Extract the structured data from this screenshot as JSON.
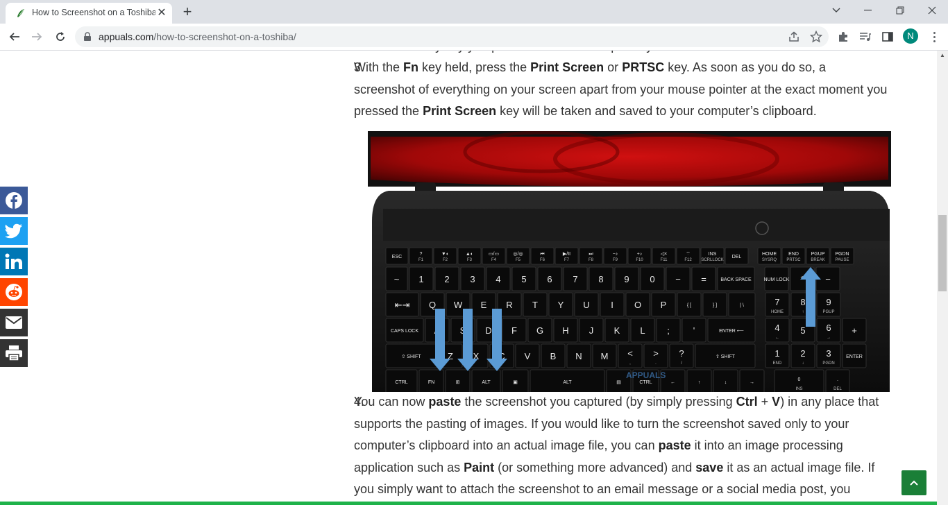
{
  "browser": {
    "tab_title": "How to Screenshot on a Toshiba",
    "url_domain": "appuals.com",
    "url_path": "/how-to-screenshot-on-a-toshiba/",
    "profile_initial": "N",
    "profile_color": "#00897b"
  },
  "article": {
    "prev_tail": "functions of any key you press instead of their primary ones.",
    "step3": {
      "num": "3.",
      "t1": "With the ",
      "b1": "Fn",
      "t2": " key held, press the ",
      "b2": "Print Screen",
      "t3": " or ",
      "b3": "PRTSC",
      "t4": " key. As soon as you do so, a screenshot of everything on your screen apart from your mouse pointer at the exact moment you pressed the ",
      "b4": "Print Screen",
      "t5": " key will be taken and saved to your computer’s clipboard."
    },
    "step4": {
      "num": "4.",
      "t1": "You can now ",
      "b1": "paste",
      "t2": " the screenshot you captured (by simply pressing ",
      "b2": "Ctrl",
      "t3": " + ",
      "b3": "V",
      "t4": ") in any place that supports the pasting of images. If you would like to turn the screenshot saved only to your computer’s clipboard into an actual image file, you can ",
      "b4": "paste",
      "t5": " it into an image processing application such as ",
      "b5": "Paint",
      "t6": " (or something more advanced) and ",
      "b6": "save",
      "t7": " it as an actual image file. If you simply want to attach the screenshot to an email message or a social media post, you"
    },
    "image_watermark": "APPUALS"
  },
  "keyboard_labels": {
    "row_fn": [
      "ESC",
      "?",
      "▼◐",
      "▲◐",
      "▭/▭",
      "◎/◎",
      "⏮",
      "▶/II",
      "⏭",
      "−♪",
      "+♪",
      "◁×",
      "⌔",
      "INS",
      "DEL",
      "HOME",
      "END",
      "PGUP",
      "PGDN"
    ],
    "row_fn_sub": [
      "",
      "F1",
      "F2",
      "F3",
      "F4",
      "F5",
      "F6",
      "F7",
      "F8",
      "F9",
      "F10",
      "F11",
      "F12",
      "SCRLLOCK",
      "",
      "SYSRQ",
      "PRTSC",
      "BREAK",
      "PAUSE"
    ],
    "row_num": [
      "~",
      "1",
      "2",
      "3",
      "4",
      "5",
      "6",
      "7",
      "8",
      "9",
      "0",
      "−",
      "=",
      "BACK SPACE",
      "NUM LOCK",
      "*",
      "−"
    ],
    "row_q": [
      "⇤⇥",
      "Q",
      "W",
      "E",
      "R",
      "T",
      "Y",
      "U",
      "I",
      "O",
      "P",
      "{ [",
      "} ]",
      "| \\",
      "7",
      "8",
      "9"
    ],
    "row_q_sub": [
      "",
      "",
      "",
      "",
      "",
      "",
      "",
      "",
      "",
      "",
      "",
      "",
      "",
      "",
      "HOME",
      "↑",
      "PGUP"
    ],
    "row_a": [
      "CAPS LOCK",
      "A",
      "S",
      "D",
      "F",
      "G",
      "H",
      "J",
      "K",
      "L",
      ";",
      "'",
      "ENTER ⟵",
      "4",
      "5",
      "6",
      "+"
    ],
    "row_a_sub": [
      "",
      "",
      "",
      "",
      "",
      "",
      "",
      "",
      "",
      "",
      "",
      "",
      "",
      "←",
      "",
      "→",
      ""
    ],
    "row_z": [
      "⇧ SHIFT",
      "Z",
      "X",
      "C",
      "V",
      "B",
      "N",
      "M",
      "<",
      ">",
      "?",
      "⇧ SHIFT",
      "1",
      "2",
      "3",
      "ENTER"
    ],
    "row_z_sub": [
      "",
      "",
      "",
      "",
      "",
      "",
      "",
      "",
      ",",
      ".",
      "/",
      "",
      "END",
      "↓",
      "PGDN",
      ""
    ],
    "row_bottom": [
      "CTRL",
      "FN",
      "⊞",
      "ALT",
      "▣",
      "ALT",
      "▤",
      "CTRL",
      "←",
      "↑",
      "↓",
      "→",
      "0",
      "."
    ],
    "row_bottom_sub": [
      "",
      "",
      "",
      "",
      "",
      "",
      "",
      "",
      "",
      "",
      "",
      "",
      "INS",
      "DEL"
    ]
  },
  "share": [
    {
      "name": "facebook",
      "color": "#3b5998"
    },
    {
      "name": "twitter",
      "color": "#1da1f2"
    },
    {
      "name": "linkedin",
      "color": "#0077b5"
    },
    {
      "name": "reddit",
      "color": "#ff4500"
    },
    {
      "name": "email",
      "color": "#333333"
    },
    {
      "name": "print",
      "color": "#333333"
    }
  ],
  "accent": "#1a7f37"
}
